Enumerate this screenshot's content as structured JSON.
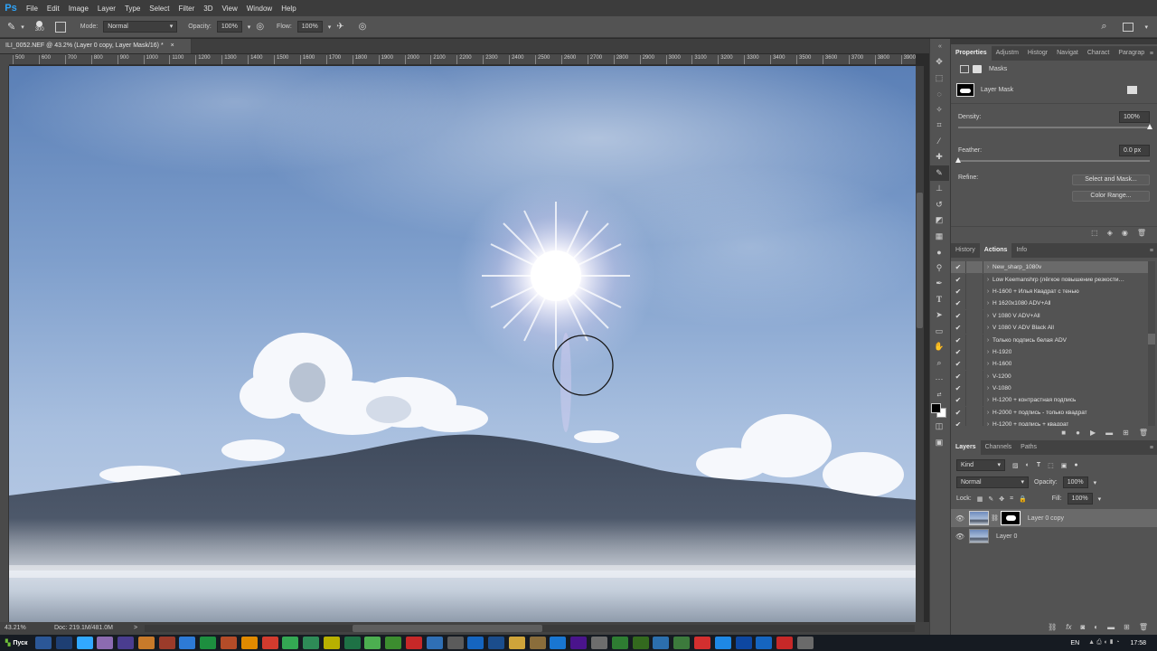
{
  "app": {
    "logo": "Ps"
  },
  "menu": [
    "File",
    "Edit",
    "Image",
    "Layer",
    "Type",
    "Select",
    "Filter",
    "3D",
    "View",
    "Window",
    "Help"
  ],
  "options": {
    "brush_size": "300",
    "mode_label": "Mode:",
    "mode_value": "Normal",
    "opacity_label": "Opacity:",
    "opacity_value": "100%",
    "flow_label": "Flow:",
    "flow_value": "100%"
  },
  "document": {
    "tab_title": "ILI_0052.NEF @ 43.2% (Layer 0 copy, Layer Mask/16) *",
    "close": "×"
  },
  "ruler": {
    "top": [
      "500",
      "600",
      "700",
      "800",
      "900",
      "1000",
      "1100",
      "1200",
      "1300",
      "1400",
      "1500",
      "1600",
      "1700",
      "1800",
      "1900",
      "2000",
      "2100",
      "2200",
      "2300",
      "2400",
      "2500",
      "2600",
      "2700",
      "2800",
      "2900",
      "3000",
      "3100",
      "3200",
      "3300",
      "3400",
      "3500",
      "3600",
      "3700",
      "3800",
      "3900"
    ]
  },
  "status": {
    "zoom": "43.21%",
    "doc": "Doc: 219.1M/481.0M",
    "arrow": ">"
  },
  "properties": {
    "tabs": [
      "Properties",
      "Adjustm",
      "Histogr",
      "Navigat",
      "Charact",
      "Paragrap"
    ],
    "section": "Masks",
    "layer_mask": "Layer Mask",
    "density_label": "Density:",
    "density_value": "100%",
    "density_level": 1.0,
    "feather_label": "Feather:",
    "feather_value": "0.0 px",
    "feather_level": 0.0,
    "refine_label": "Refine:",
    "select_mask_button": "Select and Mask...",
    "color_range_button": "Color Range..."
  },
  "actions_panel": {
    "tabs": [
      "History",
      "Actions",
      "Info"
    ],
    "items": [
      "New_sharp_1080v",
      "Low Keemanshrp (лёгкое повышение резкости…",
      "H-1600 + Илья Квадрат с тенью",
      "H 1620x1080 ADV+All",
      "V 1080 V ADV+All",
      "V 1080 V ADV Black All",
      "Только подпись белая ADV",
      "H-1920",
      "H-1600",
      "V-1200",
      "V-1080",
      "H-1200 + контрастная подпись",
      "H-2000 + подпись - только квадрат",
      "H-1200 + подпись + квадрат"
    ]
  },
  "layers_panel": {
    "tabs": [
      "Layers",
      "Channels",
      "Paths"
    ],
    "filter_kind": "Kind",
    "blend_mode": "Normal",
    "opacity_label": "Opacity:",
    "opacity_value": "100%",
    "lock_label": "Lock:",
    "fill_label": "Fill:",
    "fill_value": "100%",
    "layers": [
      {
        "name": "Layer 0 copy",
        "selected": true,
        "has_mask": true
      },
      {
        "name": "Layer 0",
        "selected": false,
        "has_mask": false
      }
    ]
  },
  "taskbar": {
    "start_label": "Пуск",
    "language": "EN",
    "time": "17:58"
  },
  "colors": {
    "ps_blue": "#2fa3f7",
    "panel_bg": "#535353",
    "selected_row": "#6a6a6a"
  }
}
